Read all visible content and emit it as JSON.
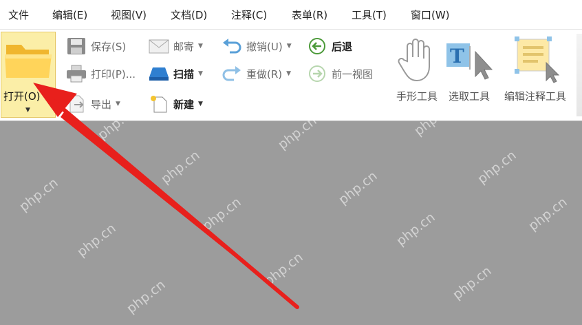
{
  "menu": [
    "文件",
    "编辑(E)",
    "视图(V)",
    "文档(D)",
    "注释(C)",
    "表单(R)",
    "工具(T)",
    "窗口(W)"
  ],
  "ribbon": {
    "open_label": "打开(O)",
    "save_label": "保存(S)",
    "print_label": "打印(P)...",
    "export_label": "导出",
    "mail_label": "邮寄",
    "scan_label": "扫描",
    "new_label": "新建",
    "undo_label": "撤销(U)",
    "redo_label": "重做(R)",
    "back_label": "后退",
    "prev_view_label": "前一视图",
    "hand_tool_label": "手形工具",
    "select_tool_label": "选取工具",
    "edit_annot_label": "编辑注释工具"
  },
  "watermark": "php.cn",
  "colors": {
    "open_highlight": "#fbeea7",
    "arrow": "#e8201c",
    "document_bg": "#9c9c9c"
  },
  "icons": [
    "folder-icon",
    "save-icon",
    "print-icon",
    "export-icon",
    "mail-icon",
    "scan-icon",
    "new-icon",
    "undo-icon",
    "redo-icon",
    "back-icon",
    "forward-icon",
    "hand-icon",
    "select-text-icon",
    "edit-annotation-icon"
  ]
}
